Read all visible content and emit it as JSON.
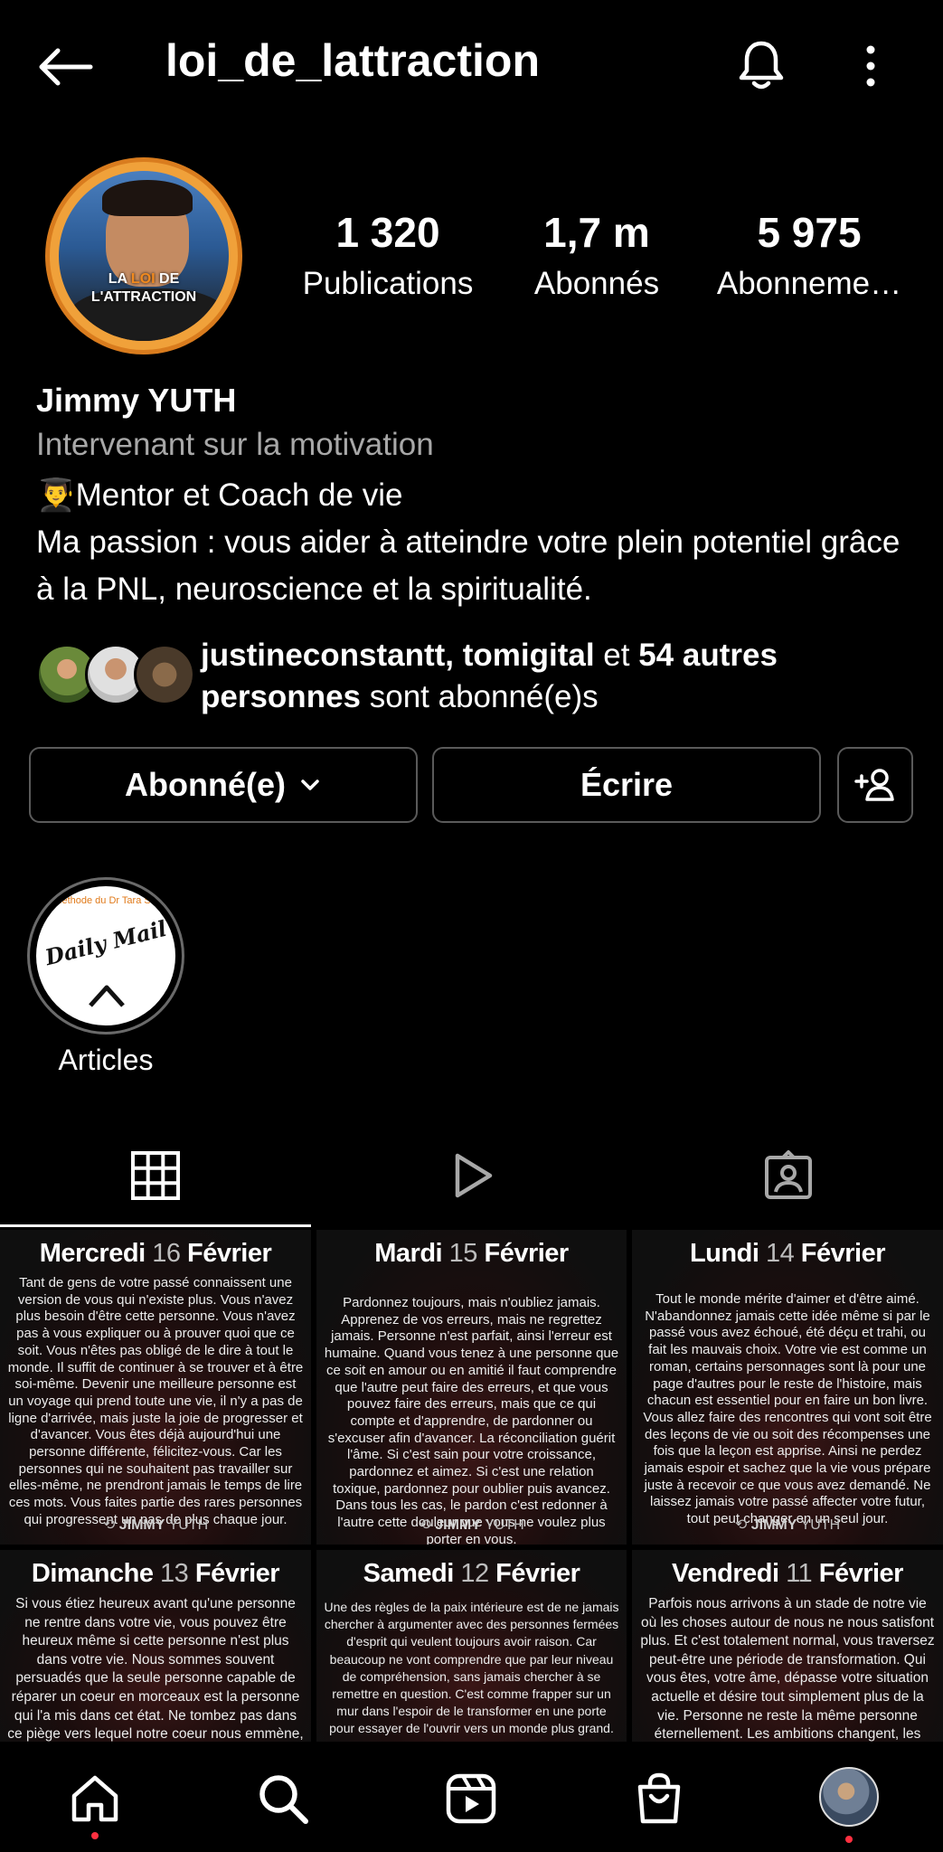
{
  "header": {
    "username": "loi_de_lattraction",
    "icons": [
      "arrow-left-icon",
      "bell-icon",
      "more-vertical-icon"
    ]
  },
  "avatar": {
    "text_line1_a": "LA ",
    "text_line1_b": "LOI",
    "text_line1_c": " DE",
    "text_line2": "L'ATTRACTION"
  },
  "stats": [
    {
      "value": "1 320",
      "label": "Publications"
    },
    {
      "value": "1,7 m",
      "label": "Abonnés"
    },
    {
      "value": "5 975",
      "label": "Abonneme…"
    }
  ],
  "bio": {
    "name": "Jimmy YUTH",
    "category": "Intervenant sur la motivation",
    "emoji": "👨‍🎓",
    "line1": "Mentor et Coach de vie",
    "line2": "Ma passion : vous aider à atteindre votre plein potentiel grâce à la PNL, neuroscience et la spiritualité."
  },
  "followed_by": {
    "names": "justineconstantt, tomigital",
    "connector": " et ",
    "others": "54 autres personnes",
    "suffix": " sont abonné(e)s"
  },
  "buttons": {
    "following": "Abonné(e)",
    "message": "Écrire",
    "add_person_icon": "add-person-icon"
  },
  "highlight": {
    "label": "Articles",
    "top_text": "Méthode du Dr Tara Sw",
    "logo": "Daily Mail"
  },
  "tabs": [
    "grid-icon",
    "reels-icon",
    "tagged-icon"
  ],
  "posts": [
    {
      "day": "Mercredi ",
      "num": "16",
      "month": " Février",
      "text": "Tant de gens de votre passé connaissent une version de vous qui n'existe plus. Vous n'avez plus besoin d'être cette personne. Vous n'avez pas à vous expliquer ou à prouver quoi que ce soit. Vous n'êtes pas obligé de le dire à tout le monde. Il suffit de continuer à se trouver et à être soi-même. Devenir une meilleure personne est un voyage qui prend toute une vie, il n'y a pas de ligne d'arrivée, mais juste la joie de progresser et d'avancer. Vous êtes déjà aujourd'hui une personne différente, félicitez-vous. Car les personnes qui ne souhaitent pas travailler sur elles-même, ne prendront jamais le temps de lire ces mots. Vous faites partie des rares personnes qui progressent un pas de plus chaque jour.",
      "sign_a": "JIMMY",
      "sign_b": " YUTH"
    },
    {
      "day": "Mardi ",
      "num": "15",
      "month": " Février",
      "text": "Pardonnez toujours, mais n'oubliez jamais. Apprenez de vos erreurs, mais ne regrettez jamais. Personne n'est parfait, ainsi l'erreur est humaine. Quand vous tenez à une personne que ce soit en amour ou en amitié il faut comprendre que l'autre peut faire des erreurs, et que vous pouvez faire des erreurs, mais que ce qui compte et d'apprendre, de pardonner ou s'excuser afin d'avancer. La réconciliation guérit l'âme. Si c'est sain pour votre croissance, pardonnez et aimez. Si c'est une relation toxique, pardonnez pour oublier puis avancez. Dans tous les cas, le pardon c'est redonner à l'autre cette douleur que vous ne voulez plus porter en vous.",
      "sign_a": "JIMMY",
      "sign_b": " YUTH"
    },
    {
      "day": "Lundi ",
      "num": "14",
      "month": " Février",
      "text": "Tout le monde mérite d'aimer et d'être aimé. N'abandonnez jamais cette idée même si par le passé vous avez échoué, été déçu et trahi, ou fait les mauvais choix. Votre vie est comme un roman, certains personnages sont là pour une page d'autres pour le reste de l'histoire, mais chacun est essentiel pour en faire un bon livre. Vous allez faire des rencontres qui vont soit être des leçons de vie ou soit des récompenses une fois que la leçon est apprise. Ainsi ne perdez jamais espoir et sachez que la vie vous prépare juste à recevoir ce que vous avez demandé. Ne laissez jamais votre passé affecter votre futur, tout peut changer en un seul jour.",
      "sign_a": "JIMMY",
      "sign_b": " YUTH"
    },
    {
      "day": "Dimanche ",
      "num": "13",
      "month": " Février",
      "text": "Si vous étiez heureux avant qu'une personne ne rentre dans votre vie, vous pouvez être heureux même si cette personne n'est plus dans votre vie. Nous sommes souvent persuadés que la seule personne capable de réparer un coeur en morceaux est la personne qui l'a mis dans cet état. Ne tombez pas dans ce piège vers lequel notre coeur nous emmène, ne dépendez jamais",
      "sign_a": "",
      "sign_b": ""
    },
    {
      "day": "Samedi ",
      "num": "12",
      "month": " Février",
      "text": "Une des règles de la paix intérieure est de ne jamais chercher à argumenter avec des personnes fermées d'esprit qui veulent toujours avoir raison. Car beaucoup ne vont comprendre que par leur niveau de compréhension, sans jamais chercher à se remettre en question. C'est comme frapper sur un mur dans l'espoir de le transformer en une porte pour essayer de l'ouvrir vers un monde plus grand. Au final vous serez la",
      "sign_a": "",
      "sign_b": ""
    },
    {
      "day": "Vendredi ",
      "num": "11",
      "month": " Février",
      "text": "Parfois nous arrivons à un stade de notre vie où les choses autour de nous ne nous satisfont plus. Et c'est totalement normal, vous traversez peut-être une période de transformation. Qui vous êtes, votre âme, dépasse votre situation actuelle et désire tout simplement plus de la vie. Personne ne reste la même personne éternellement. Les ambitions changent, les désirs évoluent, et les choses que l'on pensent",
      "sign_a": "",
      "sign_b": ""
    }
  ],
  "bottom_nav": [
    "home-icon",
    "search-icon",
    "reels-icon",
    "shop-icon",
    "profile-avatar"
  ]
}
